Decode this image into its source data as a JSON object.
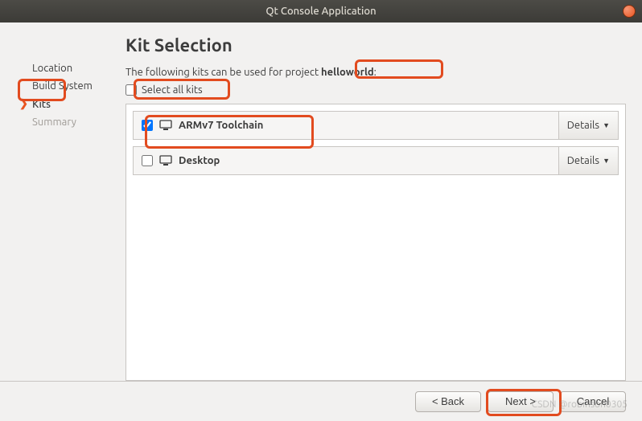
{
  "window": {
    "title": "Qt Console Application"
  },
  "sidebar": {
    "items": [
      {
        "label": "Location",
        "active": false,
        "disabled": false
      },
      {
        "label": "Build System",
        "active": false,
        "disabled": false
      },
      {
        "label": "Kits",
        "active": true,
        "disabled": false
      },
      {
        "label": "Summary",
        "active": false,
        "disabled": true
      }
    ]
  },
  "page": {
    "title": "Kit Selection",
    "intro_prefix": "The following kits can be used for project ",
    "project_name": "helloworld",
    "intro_suffix": ":",
    "select_all_label": "Select all kits"
  },
  "kits": [
    {
      "name": "ARMv7 Toolchain",
      "checked": true,
      "details_label": "Details"
    },
    {
      "name": "Desktop",
      "checked": false,
      "details_label": "Details"
    }
  ],
  "footer": {
    "back": "< Back",
    "next": "Next >",
    "cancel": "Cancel"
  },
  "watermark": "CSDN @robinson0305"
}
